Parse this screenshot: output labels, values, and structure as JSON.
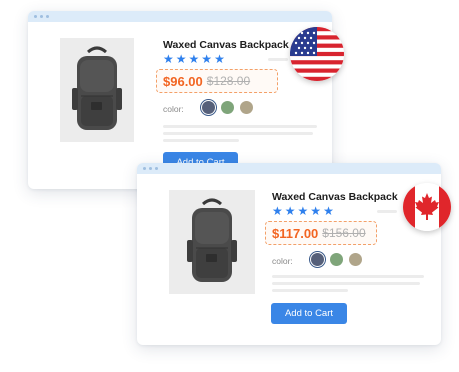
{
  "us_card": {
    "product_title": "Waxed Canvas Backpack",
    "stars": [
      "★",
      "★",
      "★",
      "★",
      "★"
    ],
    "price_now": "$96.00",
    "price_old": "$128.00",
    "color_label": "color:",
    "swatches": [
      "#56607a",
      "#7fa57a",
      "#b0a58a"
    ],
    "cart_label": "Add to Cart",
    "flag_icon": "us-flag-icon"
  },
  "ca_card": {
    "product_title": "Waxed Canvas Backpack",
    "stars": [
      "★",
      "★",
      "★",
      "★",
      "★"
    ],
    "price_now": "$117.00",
    "price_old": "$156.00",
    "color_label": "color:",
    "swatches": [
      "#56607a",
      "#7fa57a",
      "#b0a58a"
    ],
    "cart_label": "Add to Cart",
    "flag_icon": "canada-flag-icon"
  },
  "colors": {
    "accent": "#2f80ed",
    "price": "#f26522",
    "button": "#3a86e6"
  }
}
